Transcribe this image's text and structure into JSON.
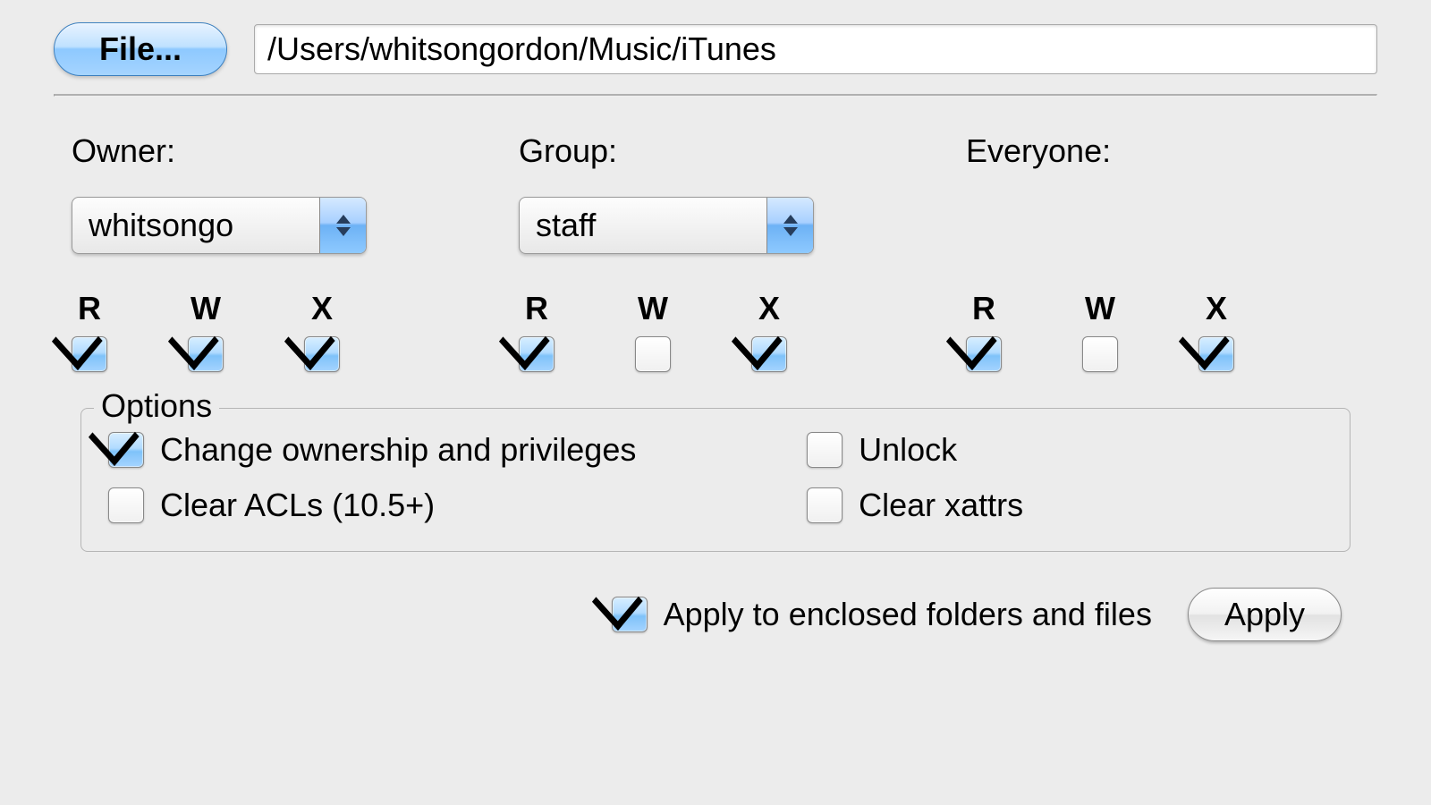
{
  "file_button_label": "File...",
  "path_value": "/Users/whitsongordon/Music/iTunes",
  "columns": {
    "owner": {
      "label": "Owner:",
      "selected": "whitsongo"
    },
    "group": {
      "label": "Group:",
      "selected": "staff"
    },
    "everyone": {
      "label": "Everyone:"
    }
  },
  "rwx_labels": {
    "r": "R",
    "w": "W",
    "x": "X"
  },
  "permissions": {
    "owner": {
      "r": true,
      "w": true,
      "x": true
    },
    "group": {
      "r": true,
      "w": false,
      "x": true
    },
    "everyone": {
      "r": true,
      "w": false,
      "x": true
    }
  },
  "options": {
    "legend": "Options",
    "change_ownership": {
      "label": "Change ownership and privileges",
      "checked": true
    },
    "unlock": {
      "label": "Unlock",
      "checked": false
    },
    "clear_acls": {
      "label": "Clear ACLs (10.5+)",
      "checked": false
    },
    "clear_xattrs": {
      "label": "Clear xattrs",
      "checked": false
    }
  },
  "apply_enclosed": {
    "label": "Apply to enclosed folders and files",
    "checked": true
  },
  "apply_button_label": "Apply"
}
